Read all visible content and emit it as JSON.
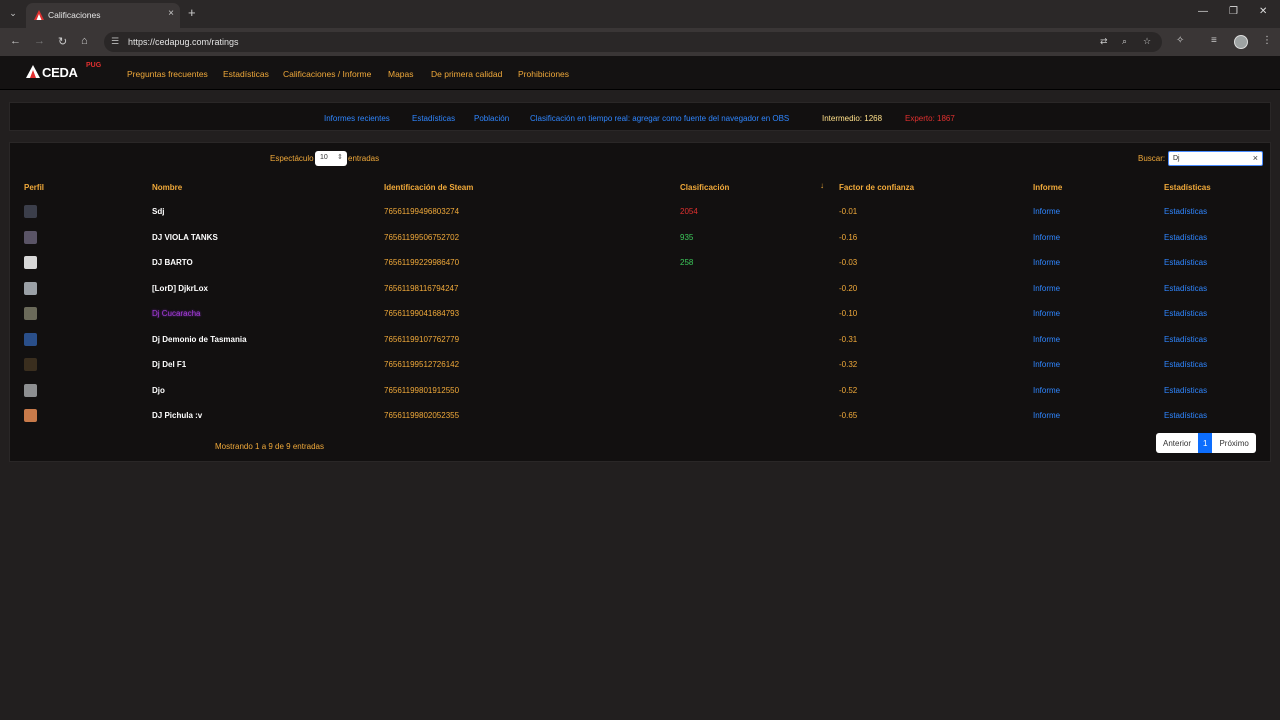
{
  "browser": {
    "tab_title": "Calificaciones",
    "url": "https://cedapug.com/ratings",
    "tab_close": "×",
    "tab_new": "+",
    "minimize": "—",
    "maximize": "❐",
    "close": "✕"
  },
  "site": {
    "logo_text": "CEDA",
    "logo_sub": "PUG",
    "nav": [
      "Preguntas frecuentes",
      "Estadísticas",
      "Calificaciones / Informe",
      "Mapas",
      "De primera calidad",
      "Prohibiciones"
    ]
  },
  "info": {
    "links": [
      "Informes recientes",
      "Estadísticas",
      "Población",
      "Clasificación en tiempo real: agregar como fuente del navegador en OBS"
    ],
    "intermediate": "Intermedio: 1268",
    "expert": "Experto: 1867"
  },
  "controls": {
    "show_label": "Espectáculo",
    "show_value": "10",
    "show_after": "entradas",
    "search_label": "Buscar:",
    "search_value": "Dj",
    "clear": "×"
  },
  "table": {
    "headers": [
      "Perfil",
      "Nombre",
      "Identificación de Steam",
      "Clasificación",
      "Factor de confianza",
      "Informe",
      "Estadísticas"
    ],
    "sort_icon": "↓",
    "rows": [
      {
        "name": "Sdj",
        "steam": "76561199496803274",
        "rating": "2054",
        "rating_color": "#e0302f",
        "conf": "-0.01",
        "inf": "Informe",
        "stats": "Estadísticas",
        "avatar": "#3b3e4a"
      },
      {
        "name": "DJ VIOLA TANKS",
        "steam": "76561199506752702",
        "rating": "935",
        "rating_color": "#3cc85a",
        "conf": "-0.16",
        "inf": "Informe",
        "stats": "Estadísticas",
        "avatar": "#5a5466"
      },
      {
        "name": "DJ BARTO",
        "steam": "76561199229986470",
        "rating": "258",
        "rating_color": "#3cc85a",
        "conf": "-0.03",
        "inf": "Informe",
        "stats": "Estadísticas",
        "avatar": "#d8d8d8"
      },
      {
        "name": "[LorD] DjkrLox",
        "steam": "76561198116794247",
        "rating": "",
        "rating_color": "#ffffff",
        "conf": "-0.20",
        "inf": "Informe",
        "stats": "Estadísticas",
        "avatar": "#9aa0a6"
      },
      {
        "name": "Dj Cucaracha",
        "steam": "76561199041684793",
        "rating": "",
        "rating_color": "#ffffff",
        "conf": "-0.10",
        "inf": "Informe",
        "stats": "Estadísticas",
        "avatar": "#6b6a5a"
      },
      {
        "name": "Dj Demonio de Tasmania",
        "steam": "76561199107762779",
        "rating": "",
        "rating_color": "#ffffff",
        "conf": "-0.31",
        "inf": "Informe",
        "stats": "Estadísticas",
        "avatar": "#2a4f8a"
      },
      {
        "name": "Dj Del F1",
        "steam": "76561199512726142",
        "rating": "",
        "rating_color": "#ffffff",
        "conf": "-0.32",
        "inf": "Informe",
        "stats": "Estadísticas",
        "avatar": "#3a2e1e"
      },
      {
        "name": "Djo",
        "steam": "76561199801912550",
        "rating": "",
        "rating_color": "#ffffff",
        "conf": "-0.52",
        "inf": "Informe",
        "stats": "Estadísticas",
        "avatar": "#8d8f91"
      },
      {
        "name": "DJ Pichula :v",
        "steam": "76561199802052355",
        "rating": "",
        "rating_color": "#ffffff",
        "conf": "-0.65",
        "inf": "Informe",
        "stats": "Estadísticas",
        "avatar": "#c87a4a"
      }
    ]
  },
  "footer": {
    "info": "Mostrando 1 a 9 de 9 entradas",
    "prev": "Anterior",
    "page": "1",
    "next": "Próximo"
  }
}
